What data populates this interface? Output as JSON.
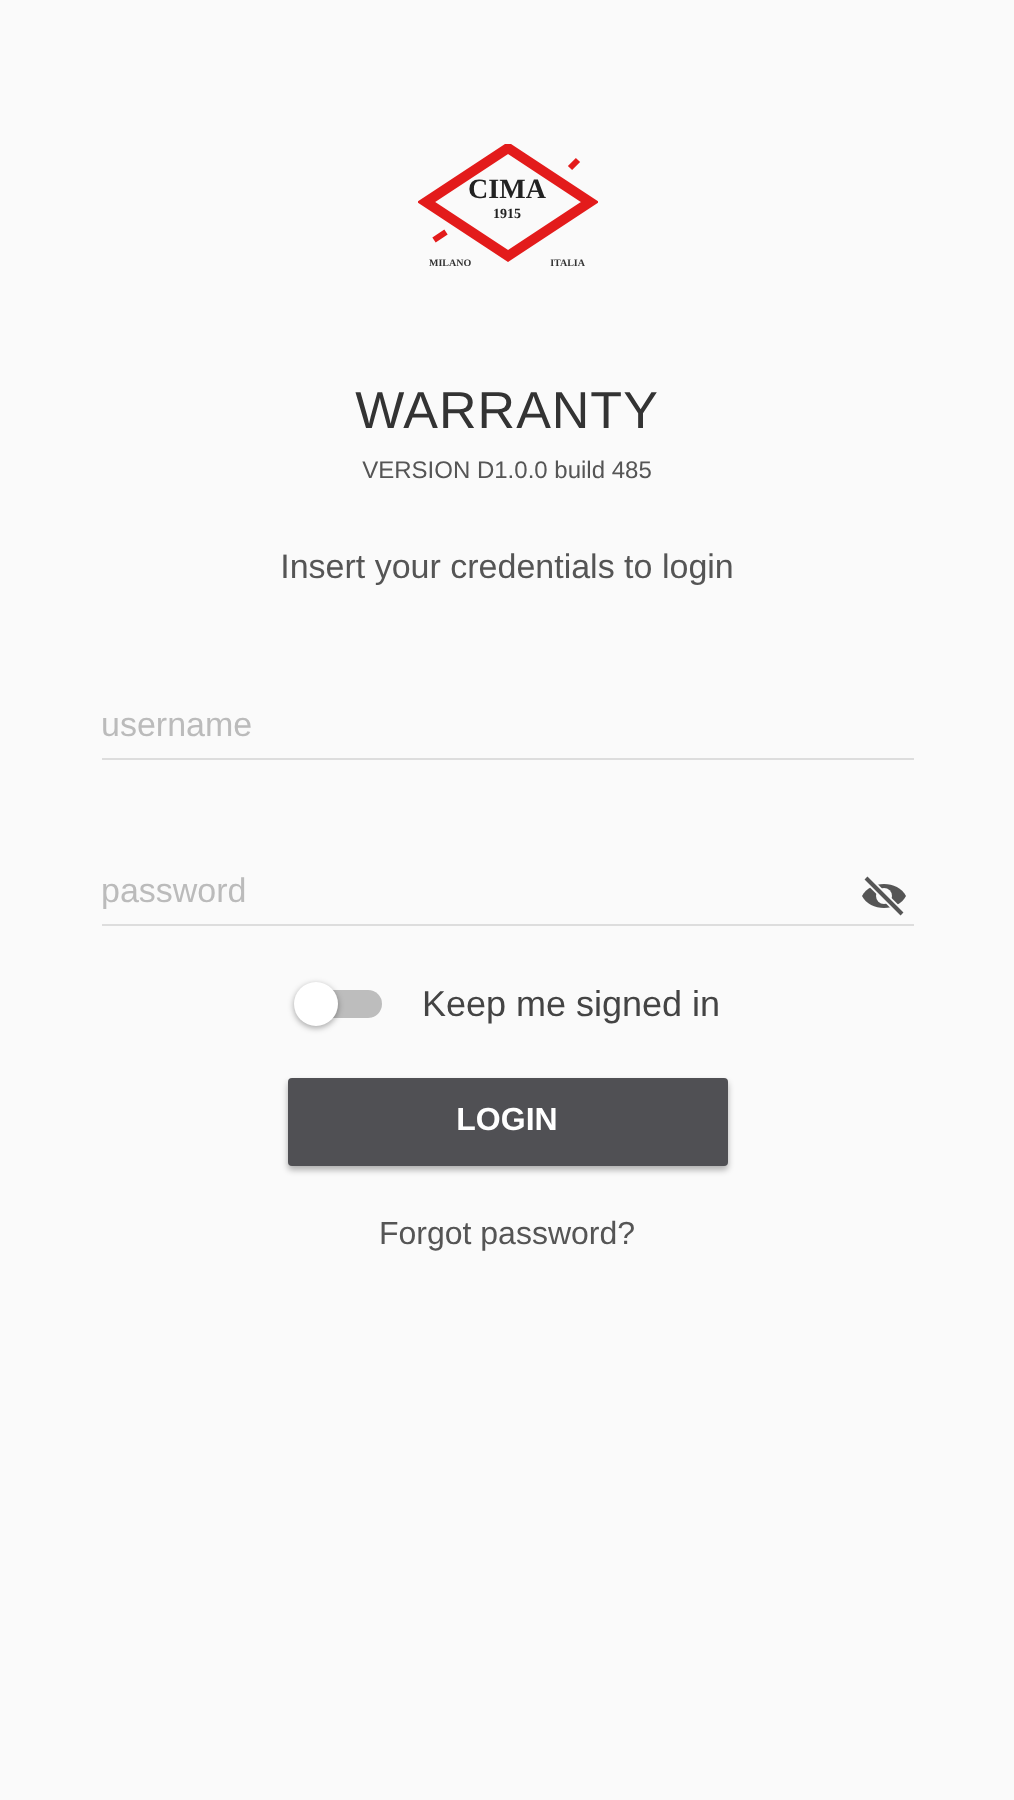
{
  "logo": {
    "name": "CIMA",
    "year": "1915",
    "city": "MILANO",
    "country": "ITALIA"
  },
  "title": "WARRANTY",
  "version": "VERSION D1.0.0 build 485",
  "instruction": "Insert your credentials to login",
  "username": {
    "placeholder": "username"
  },
  "password": {
    "placeholder": "password",
    "show_password": false
  },
  "keep_signed_in": {
    "label": "Keep me signed in",
    "on": false
  },
  "login_button": "LOGIN",
  "forgot_link": "Forgot password?"
}
